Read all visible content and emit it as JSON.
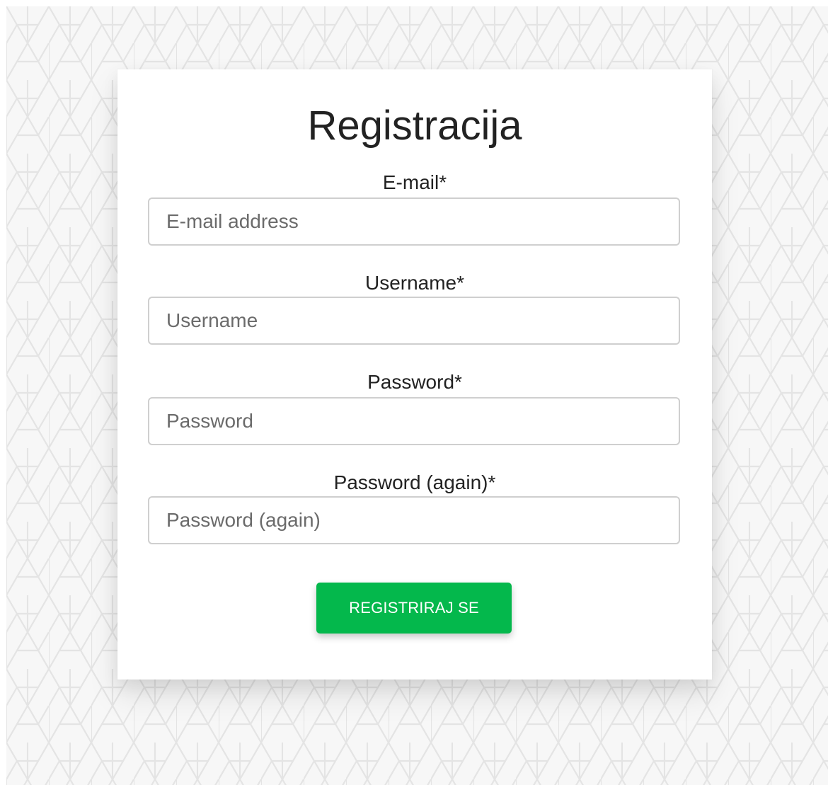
{
  "colors": {
    "button_bg": "#04b84c",
    "button_text": "#ffffff",
    "card_bg": "#ffffff",
    "page_bg": "#f7f7f7",
    "pattern_line": "#e4e4e4",
    "input_border": "#cfcfcf"
  },
  "form": {
    "title": "Registracija",
    "fields": [
      {
        "label": "E-mail*",
        "placeholder": "E-mail address",
        "value": ""
      },
      {
        "label": "Username*",
        "placeholder": "Username",
        "value": ""
      },
      {
        "label": "Password*",
        "placeholder": "Password",
        "value": ""
      },
      {
        "label": "Password (again)*",
        "placeholder": "Password (again)",
        "value": ""
      }
    ],
    "submit_label": "REGISTRIRAJ SE"
  }
}
